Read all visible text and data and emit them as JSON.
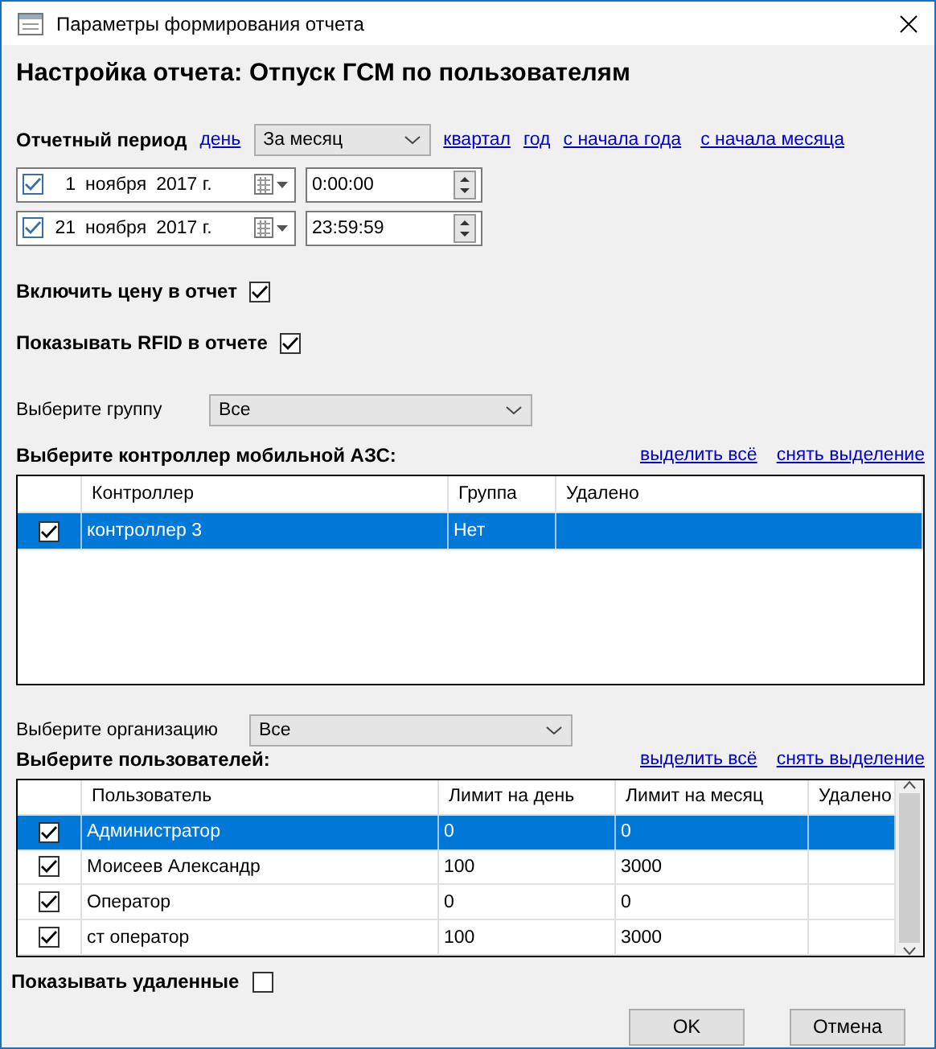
{
  "window": {
    "title": "Параметры формирования отчета"
  },
  "heading": "Настройка отчета: Отпуск ГСМ по пользователям",
  "period": {
    "label": "Отчетный период",
    "links_before": [
      "день"
    ],
    "select": "За месяц",
    "links_after": [
      "квартал",
      "год",
      "с начала года",
      "с начала месяца"
    ],
    "dates": [
      {
        "checked": true,
        "day": "1",
        "month": "ноября",
        "year": "2017 г.",
        "time": "0:00:00"
      },
      {
        "checked": true,
        "day": "21",
        "month": "ноября",
        "year": "2017 г.",
        "time": "23:59:59"
      }
    ]
  },
  "options": [
    {
      "label": "Включить цену в отчет",
      "checked": true
    },
    {
      "label": "Показывать RFID в отчете",
      "checked": true
    }
  ],
  "group": {
    "label": "Выберите группу",
    "value": "Все"
  },
  "controllers": {
    "label": "Выберите контроллер мобильной АЗС:",
    "select_all": "выделить всё",
    "deselect": "снять выделение",
    "columns": [
      "Контроллер",
      "Группа",
      "Удалено"
    ],
    "rows": [
      {
        "checked": true,
        "selected": true,
        "cells": [
          "контроллер 3",
          "Нет",
          ""
        ]
      }
    ]
  },
  "organization": {
    "label": "Выберите организацию",
    "value": "Все"
  },
  "users": {
    "label": "Выберите пользователей:",
    "select_all": "выделить всё",
    "deselect": "снять выделение",
    "columns": [
      "Пользователь",
      "Лимит на день",
      "Лимит на месяц",
      "Удалено"
    ],
    "rows": [
      {
        "checked": true,
        "selected": true,
        "cells": [
          "Администратор",
          "0",
          "0",
          ""
        ]
      },
      {
        "checked": true,
        "selected": false,
        "cells": [
          "Моисеев Александр",
          "100",
          "3000",
          ""
        ]
      },
      {
        "checked": true,
        "selected": false,
        "cells": [
          "Оператор",
          "0",
          "0",
          ""
        ]
      },
      {
        "checked": true,
        "selected": false,
        "cells": [
          "ст оператор",
          "100",
          "3000",
          ""
        ]
      }
    ]
  },
  "show_deleted": {
    "label": "Показывать удаленные",
    "checked": false
  },
  "buttons": [
    "OK",
    "Отмена"
  ]
}
